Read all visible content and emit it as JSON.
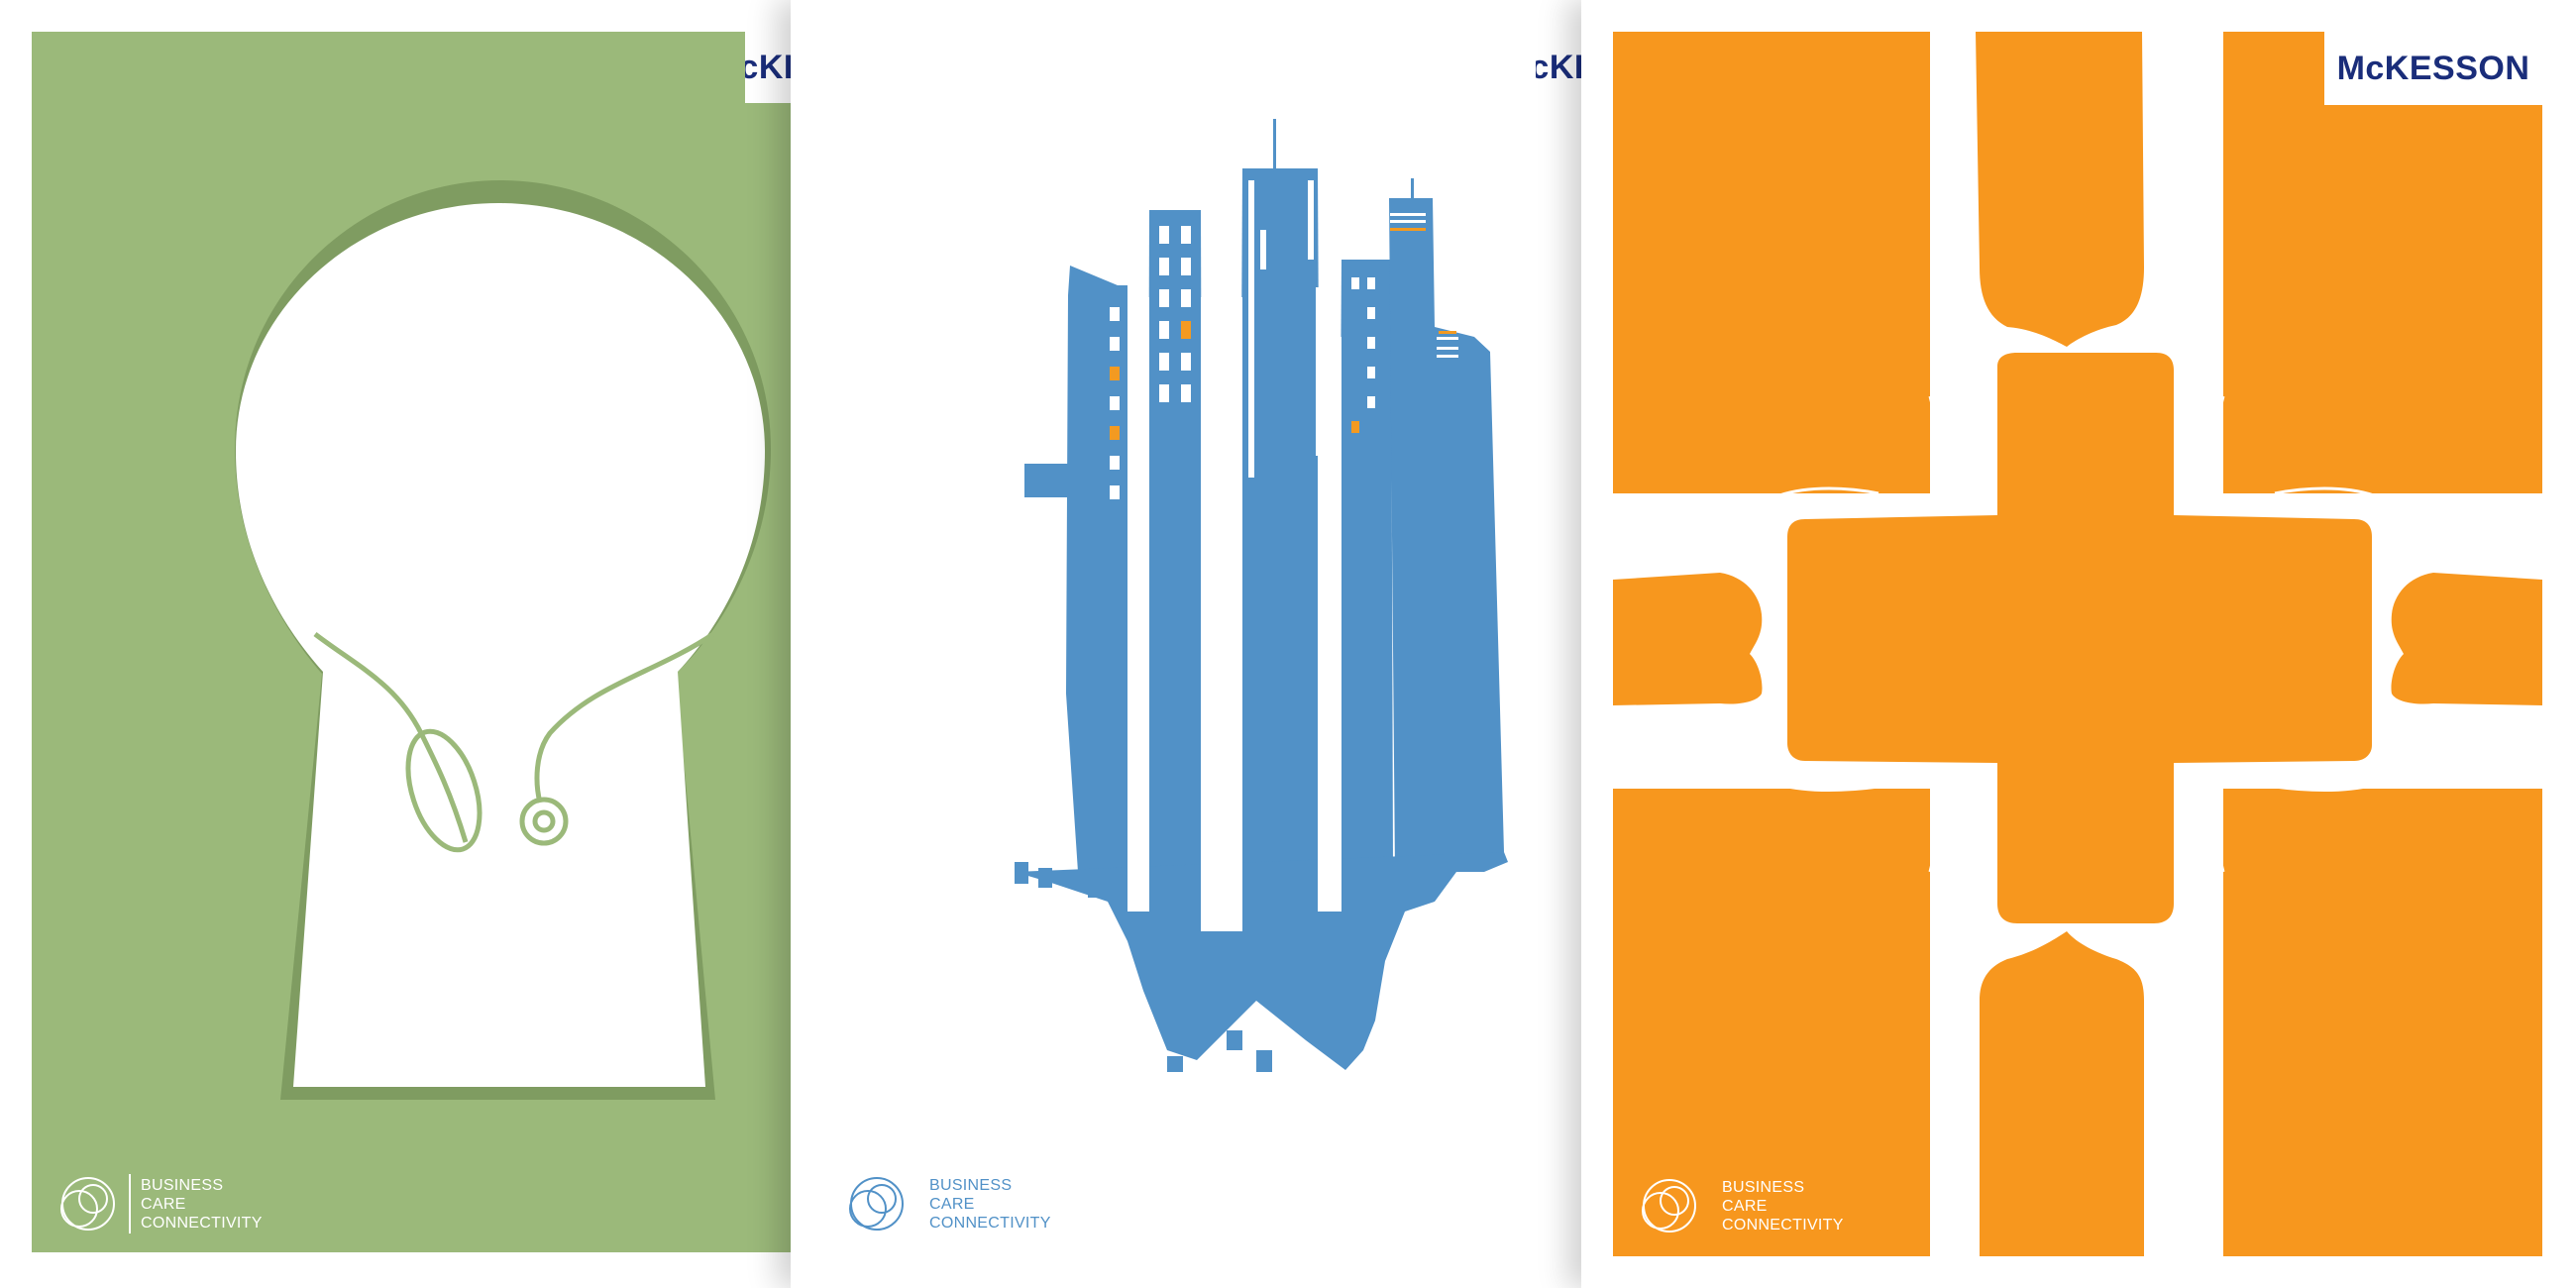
{
  "brand": {
    "logo_text": "McKESSON",
    "logo_color": "#1a2d7a"
  },
  "tagline": {
    "line1": "BUSINESS",
    "line2": "CARE",
    "line3": "CONNECTIVITY"
  },
  "posters": [
    {
      "id": "green",
      "theme_color": "#9bb97a",
      "shadow_color": "#7f9c61",
      "motif": "keyhole-stethoscope"
    },
    {
      "id": "blue",
      "theme_color": "#5191c7",
      "accent_color": "#f39a21",
      "motif": "city-skyline-gears"
    },
    {
      "id": "orange",
      "theme_color": "#f7971e",
      "motif": "hands-cross"
    }
  ]
}
